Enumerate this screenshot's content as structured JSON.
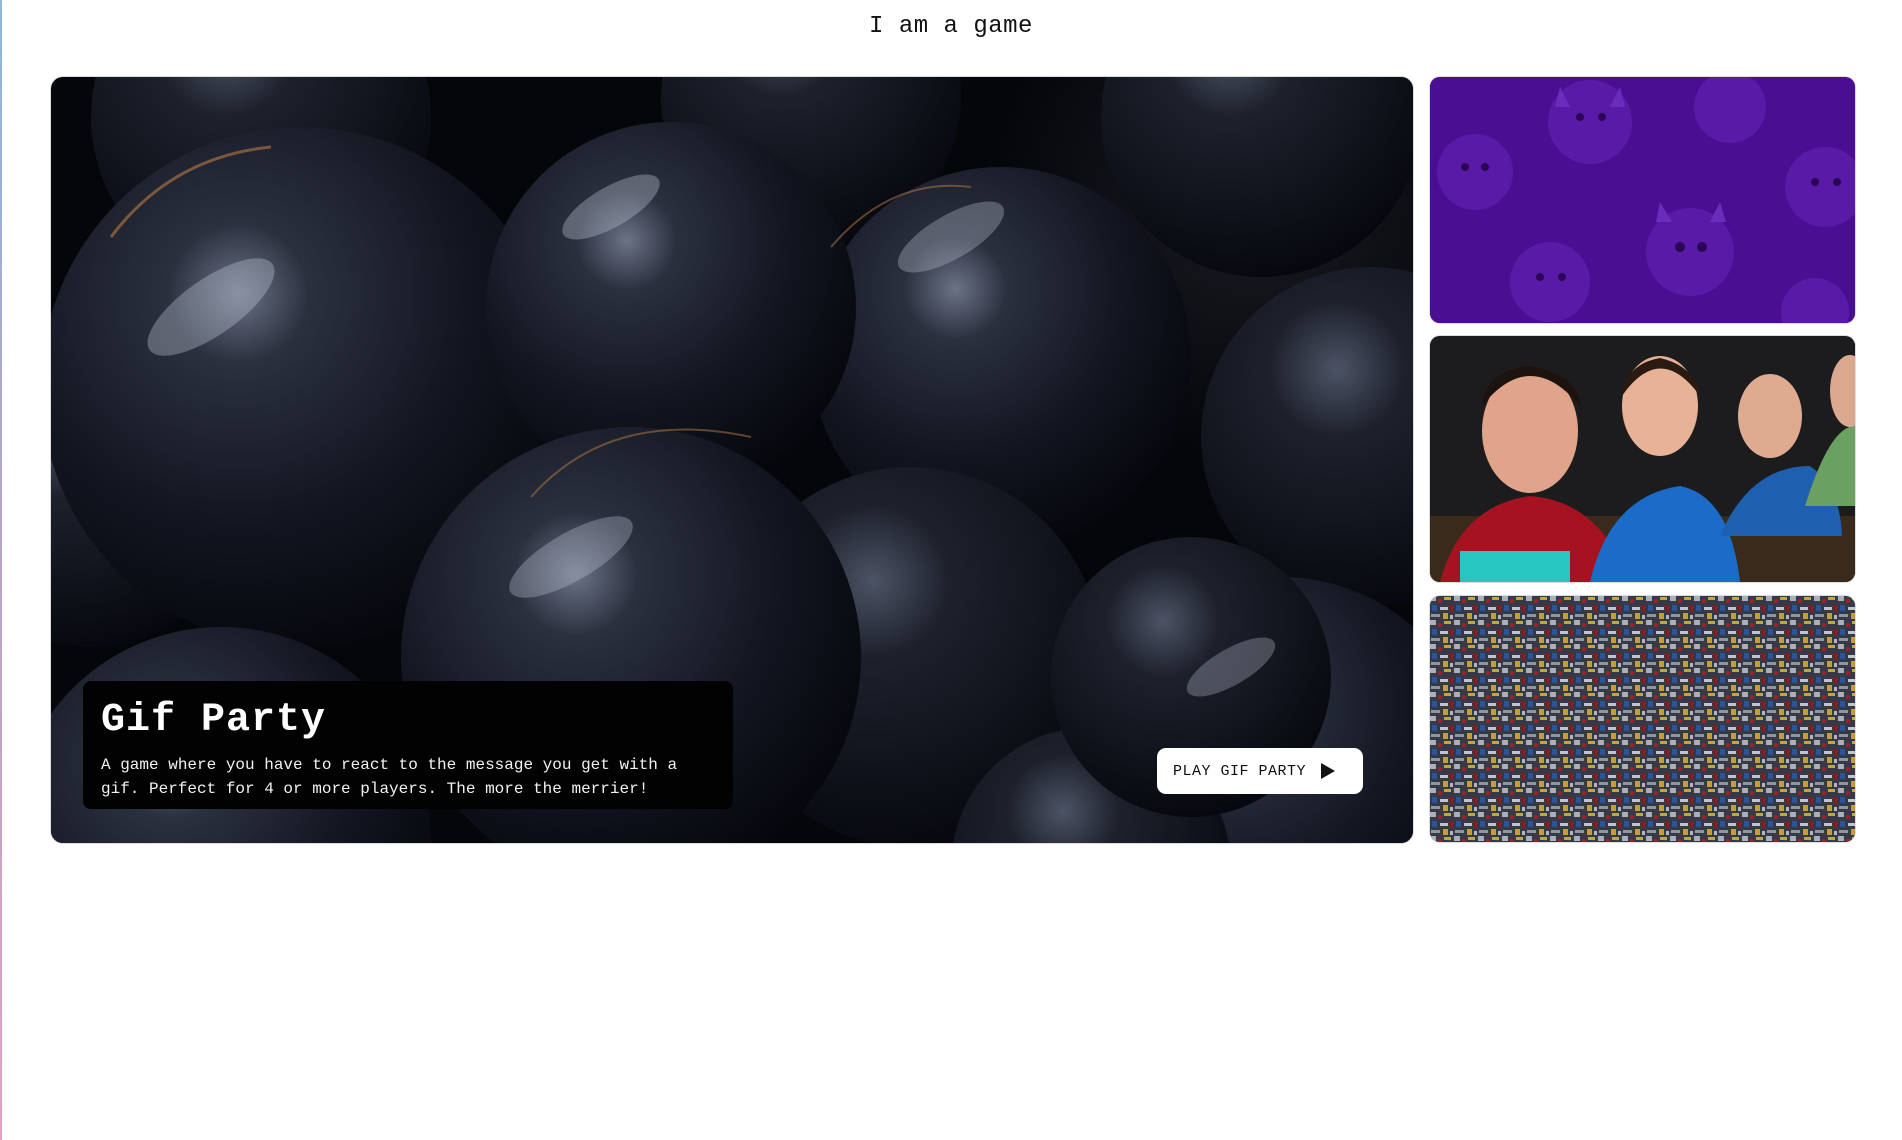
{
  "page": {
    "title": "I am a game"
  },
  "featured_game": {
    "image": "glossy-black-spheres",
    "title": "Gif Party",
    "description": "A game where you have to react to the message you get with a gif. Perfect for 4 or more players. The more the merrier!",
    "play_button_label": "PLAY GIF PARTY",
    "play_icon": "play-icon"
  },
  "thumbnails": [
    {
      "image": "purple-devil-faces-pattern",
      "background": "#4a0e92"
    },
    {
      "image": "laughing-people-gaming",
      "background": "#1a1a1c"
    },
    {
      "image": "colorful-noise-maze",
      "background": "#3a3d48"
    }
  ]
}
